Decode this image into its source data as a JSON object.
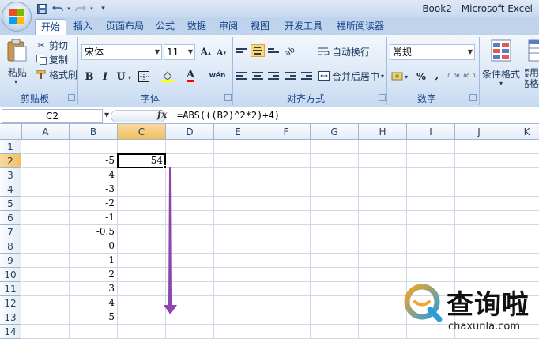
{
  "app": {
    "title": "Book2 - Microsoft Excel"
  },
  "quick_access": [
    "save-icon",
    "undo-icon",
    "redo-icon",
    "customize-icon"
  ],
  "tabs": [
    "开始",
    "插入",
    "页面布局",
    "公式",
    "数据",
    "审阅",
    "视图",
    "开发工具",
    "福昕阅读器"
  ],
  "ribbon": {
    "clipboard": {
      "paste": "粘贴",
      "cut": "剪切",
      "copy": "复制",
      "format_painter": "格式刷",
      "label": "剪贴板"
    },
    "font": {
      "name": "宋体",
      "size": "11",
      "bold": "B",
      "italic": "I",
      "underline": "U",
      "grow": "A",
      "shrink": "A",
      "font_color": "A",
      "phonetic": "wén",
      "label": "字体"
    },
    "alignment": {
      "wrap": "自动换行",
      "merge": "合并后居中",
      "label": "对齐方式"
    },
    "number": {
      "format": "常规",
      "percent": "%",
      "comma": ",",
      "inc": ".0 .00",
      "dec": ".00 .0",
      "label": "数字"
    },
    "styles": {
      "conditional": "条件格式",
      "table": "套用\n表格格"
    }
  },
  "formula_bar": {
    "name_box": "C2",
    "fx": "fx",
    "formula": "=ABS(((B2)^2*2)+4)"
  },
  "grid": {
    "columns": [
      "A",
      "B",
      "C",
      "D",
      "E",
      "F",
      "G",
      "H",
      "I",
      "J",
      "K"
    ],
    "rows": [
      "1",
      "2",
      "3",
      "4",
      "5",
      "6",
      "7",
      "8",
      "9",
      "10",
      "11",
      "12",
      "13",
      "14"
    ],
    "selected_column": "C",
    "selected_row": "2",
    "column_b": [
      "",
      "-5",
      "-4",
      "-3",
      "-2",
      "-1",
      "-0.5",
      "0",
      "1",
      "2",
      "3",
      "4",
      "5",
      ""
    ],
    "column_c": [
      "",
      "54",
      "",
      "",
      "",
      "",
      "",
      "",
      "",
      "",
      "",
      "",
      "",
      ""
    ]
  },
  "annotation": {
    "arrow_color": "#8e44ad"
  },
  "watermark": {
    "text": "查询啦",
    "url": "chaxunla.com"
  },
  "colors": {
    "accent": "#15428b",
    "selection": "#f1c15f"
  }
}
